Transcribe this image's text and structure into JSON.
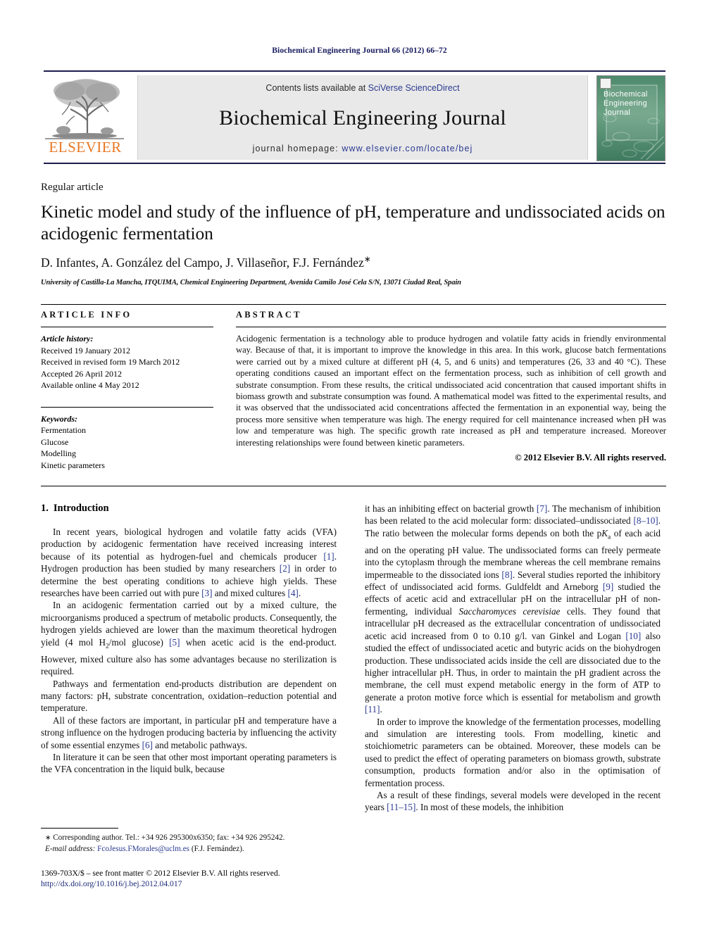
{
  "running_head": "Biochemical Engineering Journal 66 (2012) 66–72",
  "masthead": {
    "contents_prefix": "Contents lists available at ",
    "contents_link": "SciVerse ScienceDirect",
    "journal_title": "Biochemical Engineering Journal",
    "homepage_prefix": "journal homepage: ",
    "homepage_url": "www.elsevier.com/locate/bej",
    "publisher_name": "ELSEVIER",
    "publisher_color": "#e87722",
    "link_color": "#2b3a91",
    "cover_title_line1": "Biochemical",
    "cover_title_line2": "Engineering",
    "cover_title_line3": "Journal"
  },
  "article": {
    "type": "Regular article",
    "title": "Kinetic model and study of the influence of pH, temperature and undissociated acids on acidogenic fermentation",
    "authors": "D. Infantes, A. González del Campo, J. Villaseñor, F.J. Fernández",
    "corresponding_marker": "∗",
    "affiliation": "University of Castilla-La Mancha, ITQUIMA, Chemical Engineering Department, Avenida Camilo José Cela S/N, 13071 Ciudad Real, Spain"
  },
  "article_info": {
    "heading": "ARTICLE INFO",
    "history_label": "Article history:",
    "history": [
      "Received 19 January 2012",
      "Received in revised form 19 March 2012",
      "Accepted 26 April 2012",
      "Available online 4 May 2012"
    ],
    "keywords_label": "Keywords:",
    "keywords": [
      "Fermentation",
      "Glucose",
      "Modelling",
      "Kinetic parameters"
    ]
  },
  "abstract": {
    "heading": "ABSTRACT",
    "text": "Acidogenic fermentation is a technology able to produce hydrogen and volatile fatty acids in friendly environmental way. Because of that, it is important to improve the knowledge in this area. In this work, glucose batch fermentations were carried out by a mixed culture at different pH (4, 5, and 6 units) and temperatures (26, 33 and 40 °C). These operating conditions caused an important effect on the fermentation process, such as inhibition of cell growth and substrate consumption. From these results, the critical undissociated acid concentration that caused important shifts in biomass growth and substrate consumption was found. A mathematical model was fitted to the experimental results, and it was observed that the undissociated acid concentrations affected the fermentation in an exponential way, being the process more sensitive when temperature was high. The energy required for cell maintenance increased when pH was low and temperature was high. The specific growth rate increased as pH and temperature increased. Moreover interesting relationships were found between kinetic parameters.",
    "copyright": "© 2012 Elsevier B.V. All rights reserved."
  },
  "body": {
    "section_number": "1.",
    "section_title": "Introduction",
    "left_paragraphs": [
      "In recent years, biological hydrogen and volatile fatty acids (VFA) production by acidogenic fermentation have received increasing interest because of its potential as hydrogen-fuel and chemicals producer [1]. Hydrogen production has been studied by many researchers [2] in order to determine the best operating conditions to achieve high yields. These researches have been carried out with pure [3] and mixed cultures [4].",
      "In an acidogenic fermentation carried out by a mixed culture, the microorganisms produced a spectrum of metabolic products. Consequently, the hydrogen yields achieved are lower than the maximum theoretical hydrogen yield (4 mol H2/mol glucose) [5] when acetic acid is the end-product. However, mixed culture also has some advantages because no sterilization is required.",
      "Pathways and fermentation end-products distribution are dependent on many factors: pH, substrate concentration, oxidation–reduction potential and temperature.",
      "All of these factors are important, in particular pH and temperature have a strong influence on the hydrogen producing bacteria by influencing the activity of some essential enzymes [6] and metabolic pathways.",
      "In literature it can be seen that other most important operating parameters is the VFA concentration in the liquid bulk, because"
    ],
    "right_paragraphs": [
      "it has an inhibiting effect on bacterial growth [7]. The mechanism of inhibition has been related to the acid molecular form: dissociated–undissociated [8–10]. The ratio between the molecular forms depends on both the pKa of each acid and on the operating pH value. The undissociated forms can freely permeate into the cytoplasm through the membrane whereas the cell membrane remains impermeable to the dissociated ions [8]. Several studies reported the inhibitory effect of undissociated acid forms. Guldfeldt and Arneborg [9] studied the effects of acetic acid and extracellular pH on the intracellular pH of non-fermenting, individual Saccharomyces cerevisiae cells. They found that intracellular pH decreased as the extracellular concentration of undissociated acetic acid increased from 0 to 0.10 g/l. van Ginkel and Logan [10] also studied the effect of undissociated acetic and butyric acids on the biohydrogen production. These undissociated acids inside the cell are dissociated due to the higher intracellular pH. Thus, in order to maintain the pH gradient across the membrane, the cell must expend metabolic energy in the form of ATP to generate a proton motive force which is essential for metabolism and growth [11].",
      "In order to improve the knowledge of the fermentation processes, modelling and simulation are interesting tools. From modelling, kinetic and stoichiometric parameters can be obtained. Moreover, these models can be used to predict the effect of operating parameters on biomass growth, substrate consumption, products formation and/or also in the optimisation of fermentation process.",
      "As a result of these findings, several models were developed in the recent years [11–15]. In most of these models, the inhibition"
    ]
  },
  "footnotes": {
    "corresponding": "Corresponding author. Tel.: +34 926 295300x6350; fax: +34 926 295242.",
    "corresponding_marker": "∗",
    "email_label": "E-mail address:",
    "email": "FcoJesus.FMorales@uclm.es",
    "email_owner": "(F.J. Fernández).",
    "issn_line": "1369-703X/$ – see front matter © 2012 Elsevier B.V. All rights reserved.",
    "doi": "http://dx.doi.org/10.1016/j.bej.2012.04.017"
  }
}
